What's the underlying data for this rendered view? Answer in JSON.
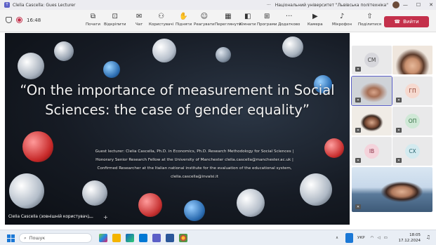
{
  "titlebar": {
    "title": "Clelia Cascella: Gues Lecturer",
    "org": "Національний університет \"Львівська політехніка\"",
    "more": "···",
    "minimize": "—",
    "maximize": "☐",
    "close": "✕"
  },
  "recording": {
    "time": "16:48"
  },
  "toolbar": {
    "items": [
      {
        "label": "Почати",
        "icon": "⧉"
      },
      {
        "label": "Відкріпити",
        "icon": "⊡"
      },
      {
        "label": "Чат",
        "icon": "✉"
      },
      {
        "label": "Користувачі",
        "icon": "⚇"
      },
      {
        "label": "Підняти",
        "icon": "✋"
      },
      {
        "label": "Реагувати",
        "icon": "☺"
      },
      {
        "label": "Переглянути",
        "icon": "▦"
      },
      {
        "label": "Кімнати",
        "icon": "◧"
      },
      {
        "label": "Програми",
        "icon": "⊞"
      },
      {
        "label": "Додатково",
        "icon": "···"
      },
      {
        "label": "Камера",
        "icon": "▶"
      },
      {
        "label": "Мікрофон",
        "icon": "♪"
      },
      {
        "label": "Поділитися",
        "icon": "⇧"
      }
    ],
    "leave_label": "Вийти"
  },
  "slide": {
    "title": "“On the importance of measurement in Social Sciences: the case of gender equality”",
    "lines": [
      "Guest lecturer: Clelia Cascella, Ph.D. in Economics, Ph.D. Research Methodology for Social Sciences |",
      "Honorary Senior Research Fellow at the University of Manchester clelia.cascella@manchester.ac.uk |",
      "Confirmed Researcher at the Italian national institute for the evaluation of the educational system,",
      "clelia.cascella@invalsi.it"
    ],
    "presenter": "Clelia Cascella (зовнішній користувач)"
  },
  "participants": [
    {
      "initials": "CM",
      "bg": "#d7d7dc",
      "fg": "#444"
    },
    {
      "initials": "ГП",
      "bg": "#f6d9cf",
      "fg": "#8b3a2b"
    },
    {
      "initials": "ОП",
      "bg": "#cfe8d6",
      "fg": "#2f6b3f"
    },
    {
      "initials": "IB",
      "bg": "#f4d3db",
      "fg": "#8b2f45"
    },
    {
      "initials": "CX",
      "bg": "#d3eaef",
      "fg": "#2a6470"
    }
  ],
  "taskbar": {
    "search_placeholder": "Пошук",
    "lang": "УКР",
    "time": "18:05",
    "date": "17.12.2024"
  }
}
